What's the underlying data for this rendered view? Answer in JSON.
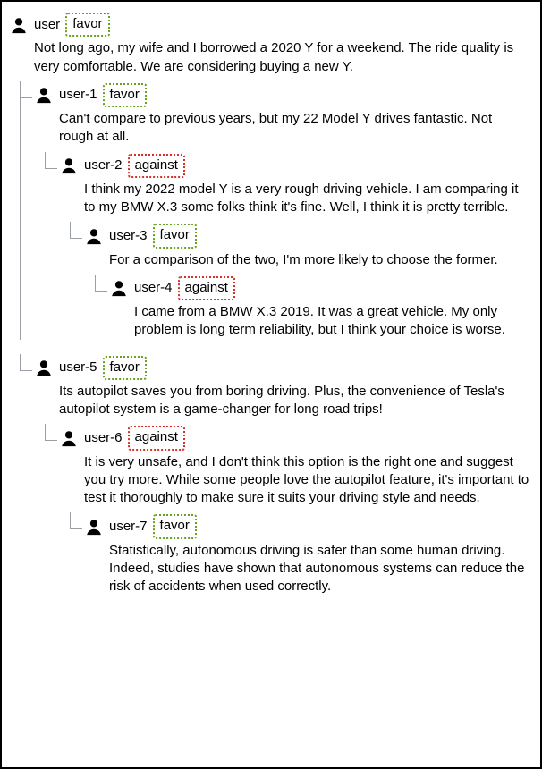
{
  "labels": {
    "favor": "favor",
    "against": "against"
  },
  "colors": {
    "favor_border": "#6aa121",
    "against_border": "#d93025"
  },
  "thread": {
    "name": "user",
    "stance": "favor",
    "text": "Not long ago, my wife and I borrowed a 2020 Y for a weekend. The ride quality is very comfortable. We are considering buying a new Y.",
    "children": [
      {
        "name": "user-1",
        "stance": "favor",
        "text": "Can't compare to previous years, but my 22 Model Y drives fantastic. Not rough at all.",
        "children": [
          {
            "name": "user-2",
            "stance": "against",
            "text": "I think my 2022 model Y is a very rough driving vehicle. I am comparing it to my BMW X.3 some folks think it's fine. Well, I think it is pretty terrible.",
            "children": [
              {
                "name": "user-3",
                "stance": "favor",
                "text": "For a comparison of the two, I'm more likely to choose the former.",
                "children": [
                  {
                    "name": "user-4",
                    "stance": "against",
                    "text": "I came from a BMW X.3 2019. It was a great vehicle. My only problem is long term reliability, but I think your choice is worse.",
                    "children": []
                  }
                ]
              }
            ]
          }
        ]
      },
      {
        "name": "user-5",
        "stance": "favor",
        "gap": true,
        "text": "Its autopilot saves you from boring driving. Plus, the convenience of Tesla's autopilot system is a game-changer for long road trips!",
        "children": [
          {
            "name": "user-6",
            "stance": "against",
            "text": "It is very unsafe, and I don't think this option is the right one and suggest you try more. While some people love the autopilot feature, it's important to test it thoroughly to make sure it suits your driving style and needs.",
            "children": [
              {
                "name": "user-7",
                "stance": "favor",
                "text": "Statistically, autonomous driving is safer than some human driving. Indeed, studies have shown that autonomous systems can reduce the risk of accidents when used correctly.",
                "children": []
              }
            ]
          }
        ]
      }
    ]
  }
}
